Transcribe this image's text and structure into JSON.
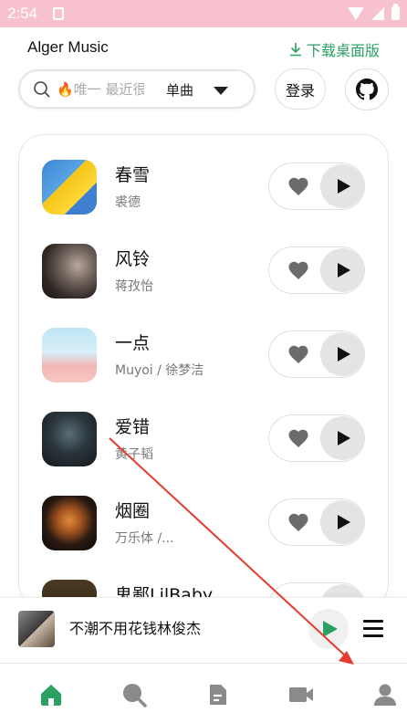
{
  "status_bar": {
    "time": "2:54"
  },
  "header": {
    "app_title": "Alger Music",
    "download_label": "下载桌面版"
  },
  "search": {
    "placeholder": "🔥唯一 最近很火",
    "type": "单曲"
  },
  "toolbar": {
    "login_label": "登录"
  },
  "songs": [
    {
      "title": "春雪",
      "artist": "裘德"
    },
    {
      "title": "风铃",
      "artist": "蒋孜怡"
    },
    {
      "title": "一点",
      "artist": "Muyoi / 徐梦洁"
    },
    {
      "title": "爱错",
      "artist": "黄子韬"
    },
    {
      "title": "烟圈",
      "artist": "万乐体 /..."
    },
    {
      "title": "鬼鄙LilBaby",
      "artist": ""
    }
  ],
  "player": {
    "title": "不潮不用花钱林俊杰"
  },
  "colors": {
    "accent": "#2aa162",
    "status_bar": "#f7c1cf",
    "annotation_arrow": "#e53a2e"
  },
  "icons": {
    "search": "search-icon",
    "like": "heart-icon",
    "play": "play-icon",
    "github": "github-icon",
    "download": "download-icon",
    "queue": "menu-icon",
    "nav": [
      "home-icon",
      "search-icon",
      "document-icon",
      "video-icon",
      "user-icon"
    ]
  }
}
